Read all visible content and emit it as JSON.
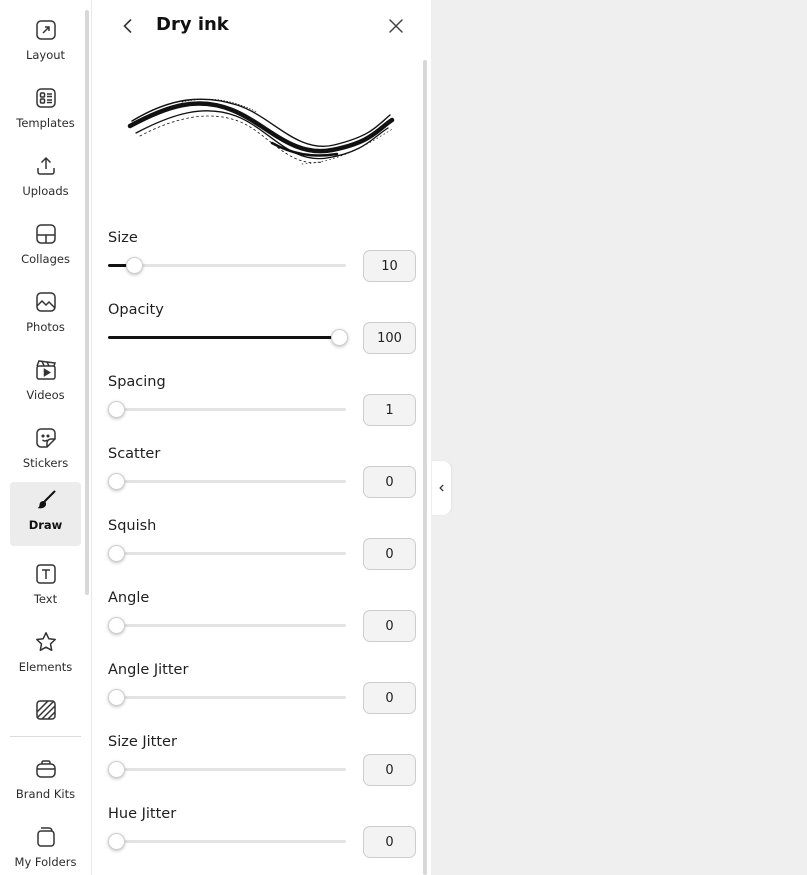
{
  "sidebar": {
    "items": [
      {
        "label": "Layout",
        "icon": "layout-icon"
      },
      {
        "label": "Templates",
        "icon": "templates-icon"
      },
      {
        "label": "Uploads",
        "icon": "upload-icon"
      },
      {
        "label": "Collages",
        "icon": "collage-icon"
      },
      {
        "label": "Photos",
        "icon": "photo-icon"
      },
      {
        "label": "Videos",
        "icon": "video-icon"
      },
      {
        "label": "Stickers",
        "icon": "sticker-icon"
      },
      {
        "label": "Draw",
        "icon": "brush-icon",
        "active": true
      },
      {
        "label": "Text",
        "icon": "text-icon"
      },
      {
        "label": "Elements",
        "icon": "star-icon"
      },
      {
        "label": "",
        "icon": "textures-icon"
      }
    ],
    "bottom_items": [
      {
        "label": "Brand Kits",
        "icon": "brand-kit-icon"
      },
      {
        "label": "My Folders",
        "icon": "folder-icon"
      }
    ]
  },
  "panel": {
    "title": "Dry ink",
    "settings": [
      {
        "name": "Size",
        "value": "10",
        "fraction": 0.11
      },
      {
        "name": "Opacity",
        "value": "100",
        "fraction": 0.97
      },
      {
        "name": "Spacing",
        "value": "1",
        "fraction": 0.0
      },
      {
        "name": "Scatter",
        "value": "0",
        "fraction": 0.0
      },
      {
        "name": "Squish",
        "value": "0",
        "fraction": 0.0
      },
      {
        "name": "Angle",
        "value": "0",
        "fraction": 0.0
      },
      {
        "name": "Angle Jitter",
        "value": "0",
        "fraction": 0.0
      },
      {
        "name": "Size Jitter",
        "value": "0",
        "fraction": 0.0
      },
      {
        "name": "Hue Jitter",
        "value": "0",
        "fraction": 0.0
      }
    ]
  },
  "colors": {
    "active_bg": "#ececec",
    "slider_fill": "#111111",
    "slider_track": "#e3e3e3",
    "canvas_bg": "#efefef"
  }
}
